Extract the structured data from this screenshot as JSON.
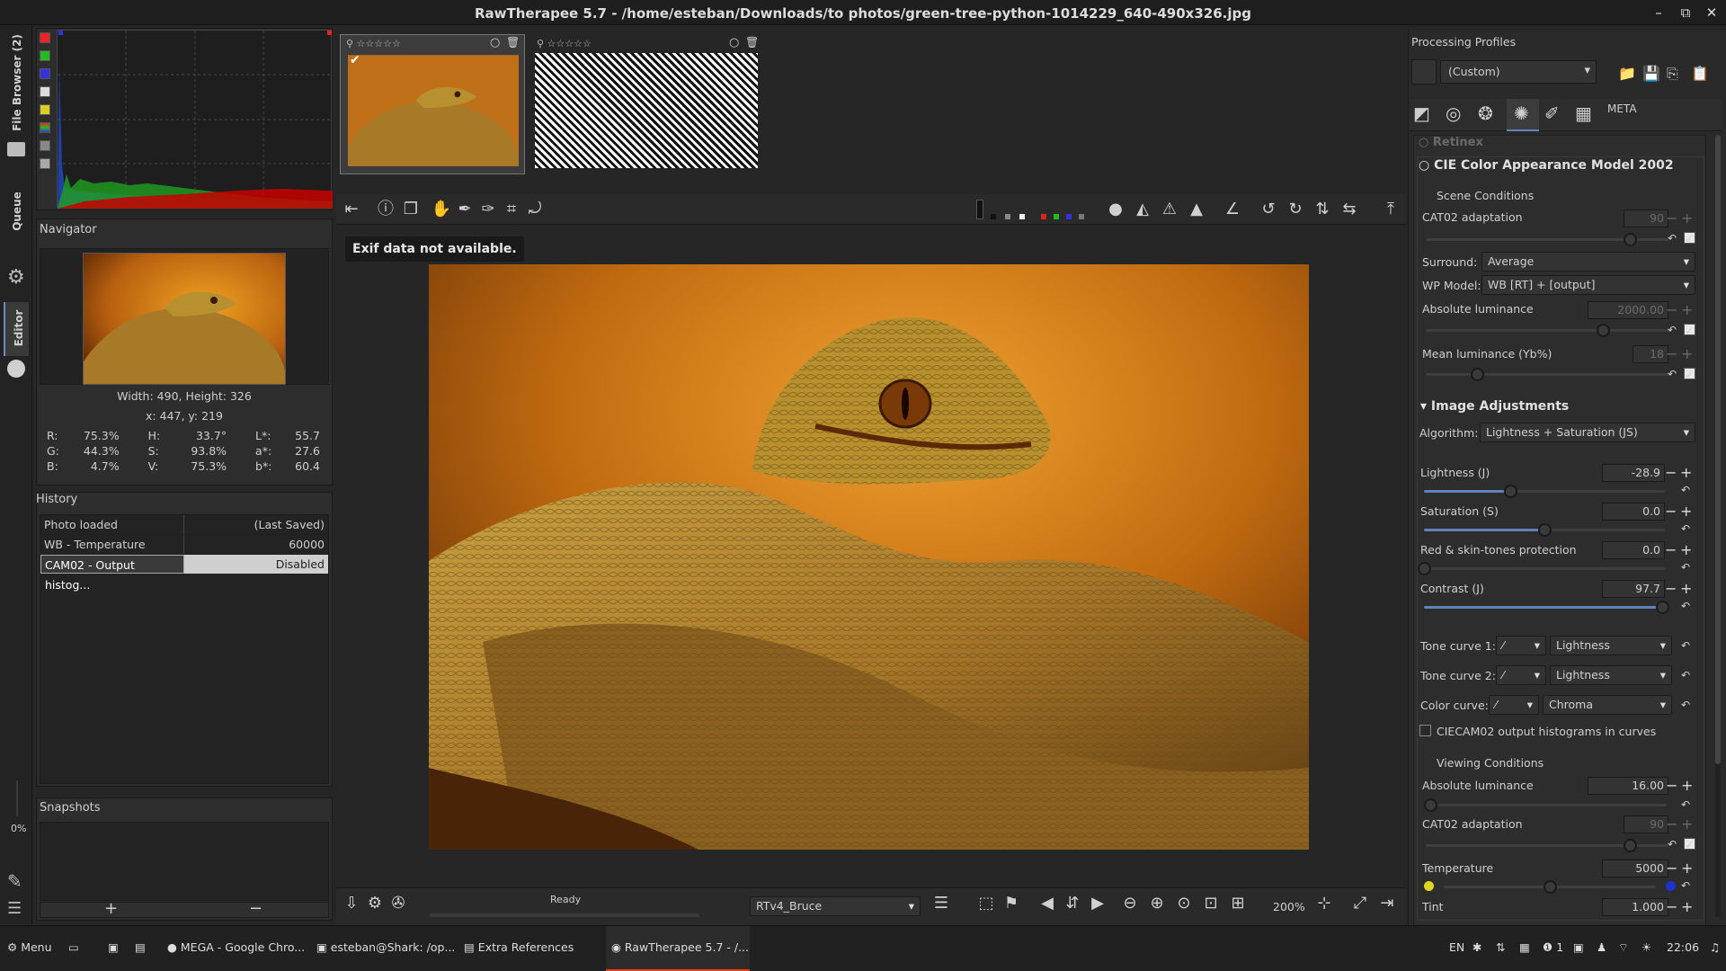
{
  "window": {
    "title": "RawTherapee 5.7 - /home/esteban/Downloads/to photos/green-tree-python-1014229_640-490x326.jpg"
  },
  "side_tabs": {
    "file_browser": "File Browser (2)",
    "queue": "Queue",
    "editor": "Editor",
    "zoom_percent": "0%"
  },
  "navigator": {
    "title": "Navigator",
    "size": "Width: 490, Height: 326",
    "coords": "x: 447, y: 219",
    "values": [
      [
        "R:",
        "75.3%",
        "H:",
        "33.7°",
        "L*:",
        "55.7"
      ],
      [
        "G:",
        "44.3%",
        "S:",
        "93.8%",
        "a*:",
        "27.6"
      ],
      [
        "B:",
        "4.7%",
        "V:",
        "75.3%",
        "b*:",
        "60.4"
      ]
    ]
  },
  "history": {
    "title": "History",
    "rows": [
      {
        "name": "Photo loaded",
        "value": "(Last Saved)"
      },
      {
        "name": "WB - Temperature",
        "value": "60000"
      },
      {
        "name": "CAM02 - Output histog...",
        "value": "Disabled"
      }
    ]
  },
  "snapshots": {
    "title": "Snapshots",
    "add": "+",
    "remove": "−"
  },
  "preview": {
    "exif_message": "Exif data not available.",
    "status": "Ready"
  },
  "bottom_toolbar": {
    "output_profile": "RTv4_Bruce",
    "zoom": "200%"
  },
  "processing_profiles": {
    "title": "Processing Profiles",
    "selected": "(Custom)"
  },
  "right_tabs": {
    "meta": "META"
  },
  "cie": {
    "retinex": "Retinex",
    "title": "CIE Color Appearance Model 2002",
    "scene": {
      "title": "Scene Conditions",
      "cat02_label": "CAT02 adaptation",
      "cat02_value": "90",
      "surround_label": "Surround:",
      "surround_value": "Average",
      "wp_label": "WP Model:",
      "wp_value": "WB [RT] + [output]",
      "abs_lum_label": "Absolute luminance",
      "abs_lum_value": "2000.00",
      "mean_lum_label": "Mean luminance (Yb%)",
      "mean_lum_value": "18"
    },
    "image_adj": {
      "title": "Image Adjustments",
      "algorithm_label": "Algorithm:",
      "algorithm_value": "Lightness + Saturation (JS)",
      "lightness_label": "Lightness (J)",
      "lightness_value": "-28.9",
      "lightness_level": 0.36,
      "saturation_label": "Saturation (S)",
      "saturation_value": "0.0",
      "saturation_level": 0.5,
      "red_label": "Red & skin-tones protection",
      "red_value": "0.0",
      "red_level": 0.0,
      "contrast_label": "Contrast (J)",
      "contrast_value": "97.7",
      "contrast_level": 0.99,
      "tone1_label": "Tone curve 1:",
      "tone1_value": "Lightness",
      "tone2_label": "Tone curve 2:",
      "tone2_value": "Lightness",
      "color_label": "Color curve:",
      "color_value": "Chroma",
      "histo_label": "CIECAM02 output histograms in curves"
    },
    "viewing": {
      "title": "Viewing Conditions",
      "abs_lum_label": "Absolute luminance",
      "abs_lum_value": "16.00",
      "abs_lum_level": 0.02,
      "cat02_label": "CAT02 adaptation",
      "cat02_value": "90",
      "temp_label": "Temperature",
      "temp_value": "5000",
      "temp_level": 0.5,
      "tint_label": "Tint",
      "tint_value": "1.000"
    }
  },
  "taskbar": {
    "menu": "Menu",
    "items": [
      "MEGA - Google Chro...",
      "esteban@Shark: /op...",
      "Extra References",
      "RawTherapee 5.7 - /..."
    ],
    "lang": "EN",
    "notif_count": "1",
    "workspace": "1",
    "clock": "22:06"
  },
  "colors": {
    "accent": "#5f83b8",
    "hist_red": "#c80000",
    "hist_green": "#1fa01f",
    "hist_blue": "#2050e0"
  }
}
